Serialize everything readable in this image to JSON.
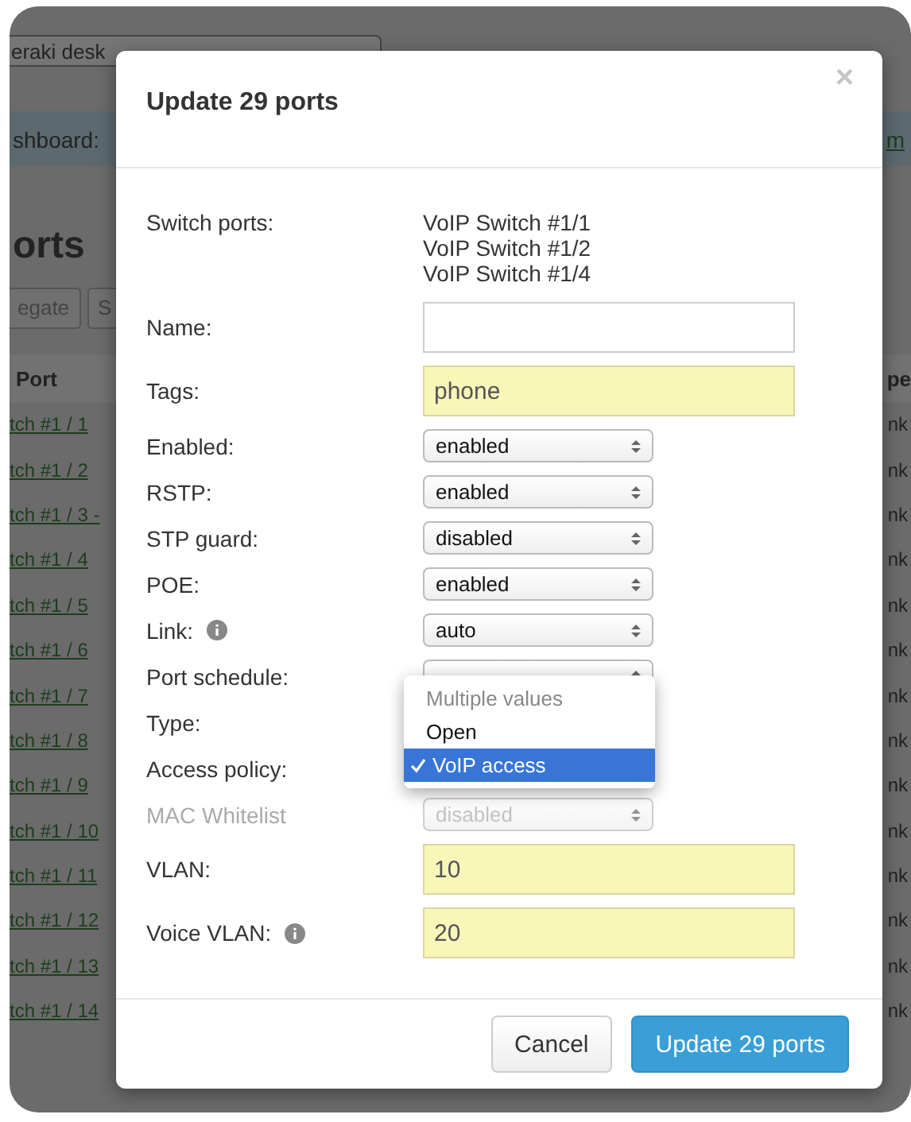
{
  "background": {
    "device_select": "eraki desk",
    "dashboard_label": "shboard:",
    "dashboard_link": "m",
    "heading": "orts",
    "buttons": [
      "egate",
      "S"
    ],
    "columns": [
      "Port",
      "pe"
    ],
    "rows": [
      {
        "port": "tch #1 / 1",
        "column_2": "nk"
      },
      {
        "port": "tch #1 / 2",
        "column_2": "nk"
      },
      {
        "port": "tch #1 / 3 -",
        "column_2": "nk"
      },
      {
        "port": "tch #1 / 4",
        "column_2": "nk"
      },
      {
        "port": "tch #1 / 5",
        "column_2": "nk"
      },
      {
        "port": "tch #1 / 6",
        "column_2": "nk"
      },
      {
        "port": "tch #1 / 7",
        "column_2": "nk"
      },
      {
        "port": "tch #1 / 8",
        "column_2": "nk"
      },
      {
        "port": "tch #1 / 9",
        "column_2": "nk"
      },
      {
        "port": "tch #1 / 10",
        "column_2": "nk"
      },
      {
        "port": "tch #1 / 11",
        "column_2": "nk"
      },
      {
        "port": "tch #1 / 12",
        "column_2": "nk"
      },
      {
        "port": "tch #1 / 13",
        "column_2": "nk"
      },
      {
        "port": "tch #1 / 14",
        "column_2": "nk"
      }
    ]
  },
  "dialog": {
    "title": "Update 29 ports",
    "close": "×",
    "fields": [
      {
        "kind": "list",
        "label": "Switch ports:",
        "items": [
          "VoIP Switch #1/1",
          "VoIP Switch #1/2",
          "VoIP Switch #1/4"
        ]
      },
      {
        "kind": "text",
        "label": "Name:",
        "changed": false
      },
      {
        "kind": "text",
        "label": "Tags:",
        "value": "phone",
        "changed": true
      },
      {
        "kind": "select",
        "label": "Enabled:",
        "value": "enabled",
        "disabled": false
      },
      {
        "kind": "select",
        "label": "RSTP:",
        "value": "enabled",
        "disabled": false
      },
      {
        "kind": "select",
        "label": "STP guard:",
        "value": "disabled",
        "disabled": false
      },
      {
        "kind": "select",
        "label": "POE:",
        "value": "enabled",
        "disabled": false
      },
      {
        "kind": "select",
        "label": "Link:",
        "info": true,
        "value": "auto",
        "disabled": false
      },
      {
        "kind": "select",
        "label": "Port schedule:",
        "disabled": false
      },
      {
        "kind": "empty",
        "label": "Type:"
      },
      {
        "kind": "dropdown",
        "label": "Access policy:",
        "options": [
          {
            "label": "Multiple values",
            "disabled": true,
            "selected": false
          },
          {
            "label": "Open",
            "disabled": false,
            "selected": false
          },
          {
            "label": "VoIP access",
            "disabled": false,
            "selected": true
          }
        ]
      },
      {
        "kind": "select",
        "label": "MAC Whitelist",
        "value": "disabled",
        "disabled": true
      },
      {
        "kind": "text",
        "label": "VLAN:",
        "value": "10",
        "changed": true
      },
      {
        "kind": "text",
        "label": "Voice VLAN:",
        "info": true,
        "value": "20",
        "changed": true
      }
    ],
    "buttons": [
      {
        "label": "Cancel",
        "kind": "secondary"
      },
      {
        "label": "Update 29 ports",
        "kind": "primary"
      }
    ]
  }
}
